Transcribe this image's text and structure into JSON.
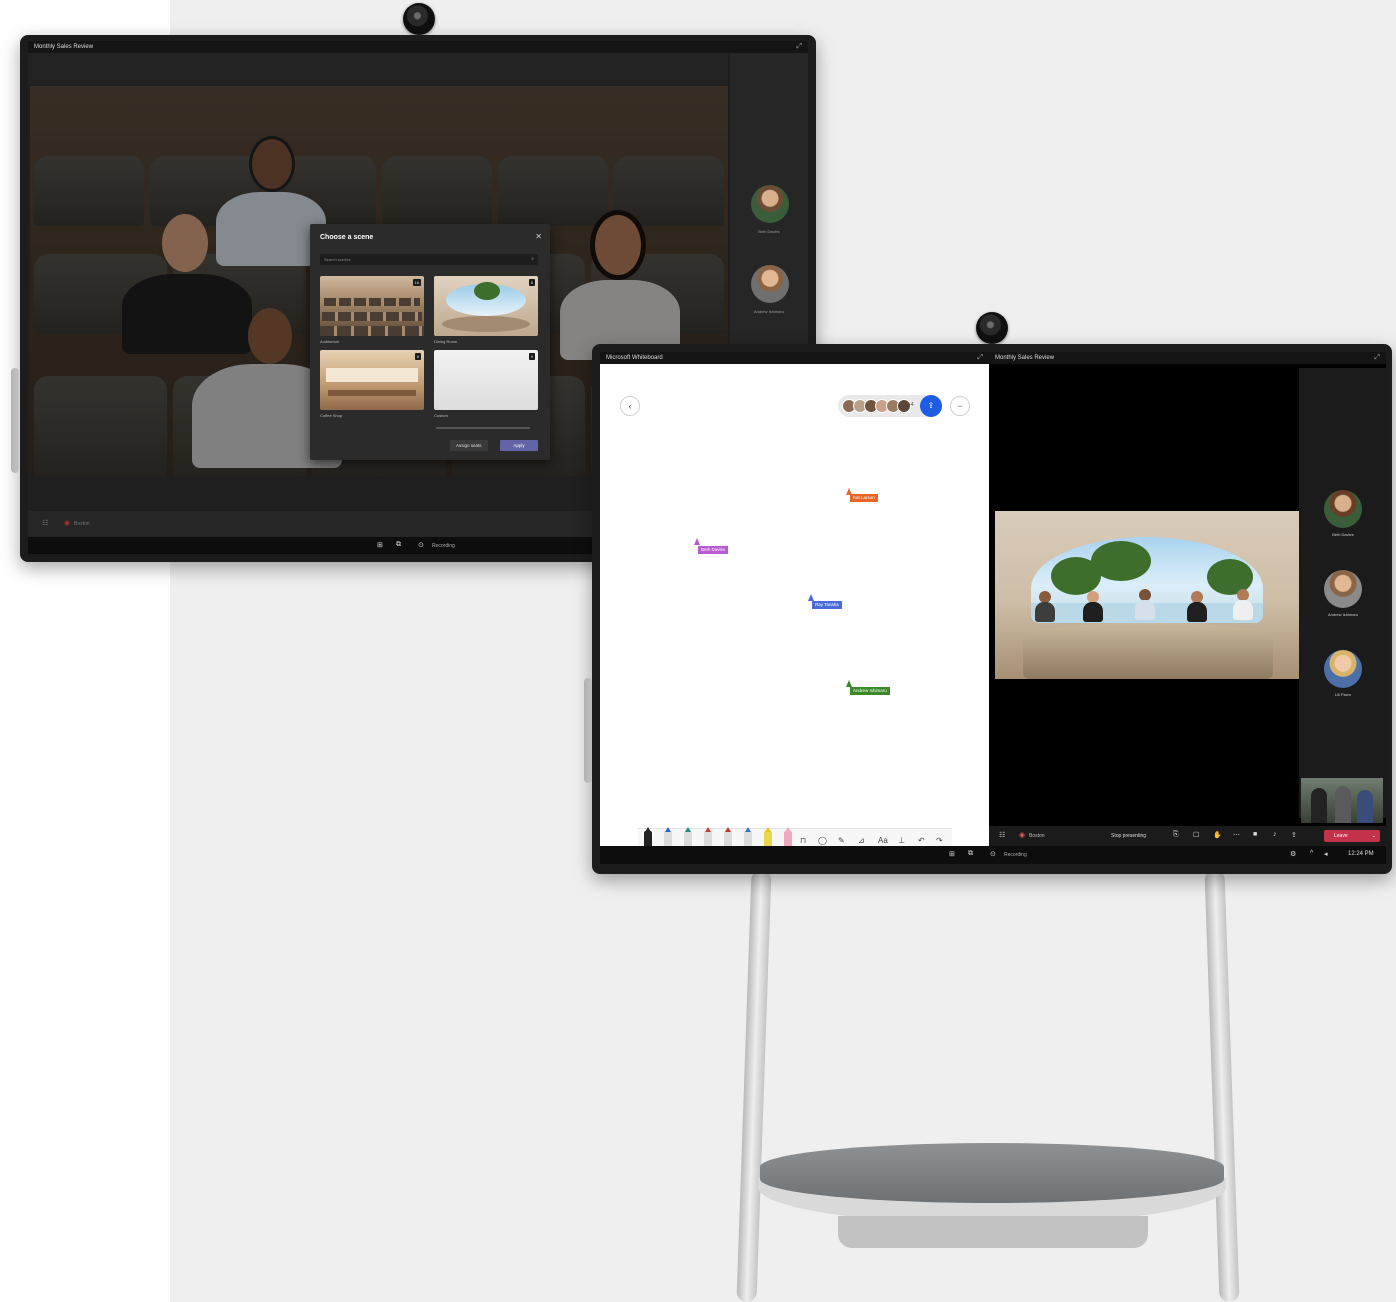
{
  "device1": {
    "window_title": "Monthly Sales Review",
    "dialog": {
      "title": "Choose a scene",
      "search_placeholder": "Search scenes",
      "scenes": [
        {
          "name": "Auditorium",
          "badge": "16"
        },
        {
          "name": "Dining Room",
          "badge": "6"
        },
        {
          "name": "Coffee Shop",
          "badge": "8"
        },
        {
          "name": "Custom",
          "badge": "9"
        }
      ],
      "assign_label": "Assign seats",
      "apply_label": "Apply"
    },
    "rail_names": [
      "Beth Davies",
      "Andrew Ishimaru"
    ],
    "bottom_left_label": "Boston",
    "taskbar_label": "Recording"
  },
  "device2": {
    "whiteboard_title": "Microsoft Whiteboard",
    "collab_count": "+4",
    "cursors": [
      {
        "name": "Kat Larson",
        "color": "#e8652a"
      },
      {
        "name": "Beth Davies",
        "color": "#b85ad0"
      },
      {
        "name": "Ray Tanaka",
        "color": "#4a6bd8"
      },
      {
        "name": "Andrew Ishimaru",
        "color": "#3a8a2a"
      }
    ],
    "meeting_title": "Monthly Sales Review",
    "rail_names": [
      "Beth Davies",
      "Andrew Ishimaru",
      "Lili Pawn"
    ],
    "room_label": "Boston",
    "stop_presenting": "Stop presenting",
    "leave_label": "Leave",
    "taskbar_label": "Recording",
    "clock": "12:24 PM"
  },
  "colors": {
    "leave": "#c4314b",
    "apply": "#6264a7",
    "share": "#1f5ce6"
  }
}
